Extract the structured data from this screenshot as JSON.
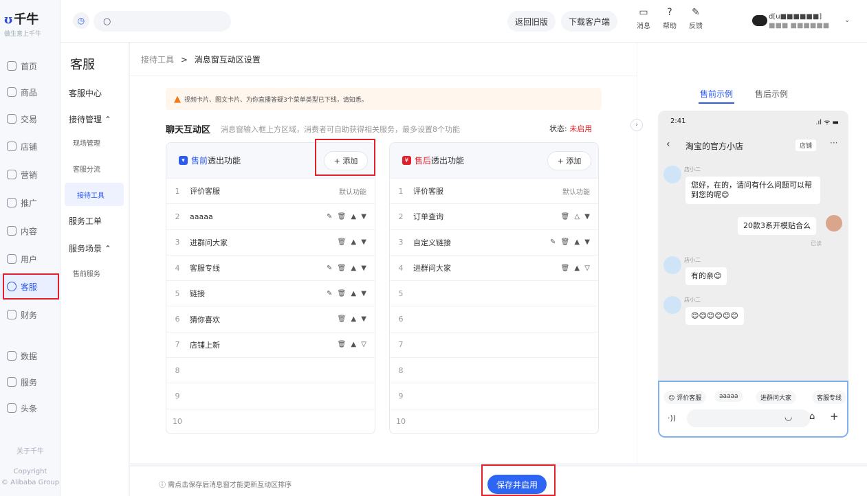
{
  "logo": {
    "brand": "千牛",
    "slogan": "做生意上千牛"
  },
  "rail": {
    "items": [
      {
        "label": "首页",
        "icon": "home-icon"
      },
      {
        "label": "商品",
        "icon": "goods-icon"
      },
      {
        "label": "交易",
        "icon": "trade-icon"
      },
      {
        "label": "店铺",
        "icon": "shop-icon"
      },
      {
        "label": "营销",
        "icon": "marketing-icon"
      },
      {
        "label": "推广",
        "icon": "promote-icon"
      },
      {
        "label": "内容",
        "icon": "content-icon"
      },
      {
        "label": "用户",
        "icon": "user-icon"
      },
      {
        "label": "客服",
        "icon": "headset-icon"
      },
      {
        "label": "财务",
        "icon": "finance-icon"
      },
      {
        "label": "数据",
        "icon": "data-icon"
      },
      {
        "label": "服务",
        "icon": "service-icon"
      },
      {
        "label": "头条",
        "icon": "news-icon"
      }
    ],
    "about": "关于千牛",
    "copyright": "Copyright",
    "company": "© Alibaba Group"
  },
  "topbar": {
    "back_old": "返回旧版",
    "download": "下载客户端",
    "msg": "消息",
    "help": "帮助",
    "feedback": "反馈",
    "user": "d[u■■■■■■]",
    "user_sub": "■■■ ■■■■■■"
  },
  "subnav": {
    "title": "客服",
    "items": [
      {
        "label": "客服中心",
        "sub": false
      },
      {
        "label": "接待管理 ⌃",
        "sub": false
      },
      {
        "label": "现场管理",
        "sub": true
      },
      {
        "label": "客服分流",
        "sub": true
      },
      {
        "label": "接待工具",
        "sub": true,
        "selected": true
      },
      {
        "label": "服务工单",
        "sub": false
      },
      {
        "label": "服务场景 ⌃",
        "sub": false
      },
      {
        "label": "售前服务",
        "sub": true
      }
    ]
  },
  "breadcrumb": {
    "parent": "接待工具",
    "sep": ">",
    "current": "消息窗互动区设置"
  },
  "notice": "视频卡片、图文卡片、为你直播答疑3个菜单类型已下线，请知悉。",
  "section": {
    "title": "聊天互动区",
    "desc": "消息窗输入框上方区域，消费者可自助获得相关服务，最多设置8个功能",
    "status_label": "状态: ",
    "status_value": "未启用"
  },
  "presale": {
    "badge": "▾",
    "hl": "售前",
    "title": "透出功能",
    "add": "+ 添加",
    "rows": [
      {
        "n": "1",
        "label": "评价客服",
        "ops": "",
        "def": "默认功能"
      },
      {
        "n": "2",
        "label": "aaaaa",
        "ops": "✎ 🗑 ▲ ▼",
        "def": ""
      },
      {
        "n": "3",
        "label": "进群问大家",
        "ops": "🗑 ▲ ▼",
        "def": ""
      },
      {
        "n": "4",
        "label": "客服专线",
        "ops": "✎ 🗑 ▲ ▼",
        "def": ""
      },
      {
        "n": "5",
        "label": "链接",
        "ops": "✎ 🗑 ▲ ▼",
        "def": ""
      },
      {
        "n": "6",
        "label": "猜你喜欢",
        "ops": "🗑 ▲ ▼",
        "def": ""
      },
      {
        "n": "7",
        "label": "店铺上新",
        "ops": "🗑 ▲ ▽",
        "def": ""
      },
      {
        "n": "8",
        "label": "",
        "ops": "",
        "def": ""
      },
      {
        "n": "9",
        "label": "",
        "ops": "",
        "def": ""
      },
      {
        "n": "10",
        "label": "",
        "ops": "",
        "def": ""
      }
    ]
  },
  "aftersale": {
    "badge": "¥",
    "hl": "售后",
    "title": "透出功能",
    "add": "+ 添加",
    "rows": [
      {
        "n": "1",
        "label": "评价客服",
        "ops": "",
        "def": "默认功能"
      },
      {
        "n": "2",
        "label": "订单查询",
        "ops": "🗑 △ ▼",
        "def": ""
      },
      {
        "n": "3",
        "label": "自定义链接",
        "ops": "✎ 🗑 ▲ ▼",
        "def": ""
      },
      {
        "n": "4",
        "label": "进群问大家",
        "ops": "🗑 ▲ ▽",
        "def": ""
      },
      {
        "n": "5",
        "label": "",
        "ops": "",
        "def": ""
      },
      {
        "n": "6",
        "label": "",
        "ops": "",
        "def": ""
      },
      {
        "n": "7",
        "label": "",
        "ops": "",
        "def": ""
      },
      {
        "n": "8",
        "label": "",
        "ops": "",
        "def": ""
      },
      {
        "n": "9",
        "label": "",
        "ops": "",
        "def": ""
      },
      {
        "n": "10",
        "label": "",
        "ops": "",
        "def": ""
      }
    ]
  },
  "preview": {
    "tab_pre": "售前示例",
    "tab_after": "售后示例",
    "time": "2:41",
    "signal": ".ıl ᯤ ▬",
    "shop": "淘宝的官方小店",
    "store": "店铺",
    "bot": "店小二",
    "msg1": "您好，在的，请问有什么问题可以帮到您的呢😊",
    "msg2": "20款3系开模贴合么",
    "read": "已读",
    "msg3": "有的亲😊",
    "msg4": "😊😊😊😊😊😊",
    "chips": [
      "☺ 评价客服",
      "aaaaa",
      "进群问大家",
      "客服专线"
    ]
  },
  "footer": {
    "tip": "ⓘ 需点击保存后消息窗才能更新互动区排序",
    "save": "保存并启用"
  }
}
